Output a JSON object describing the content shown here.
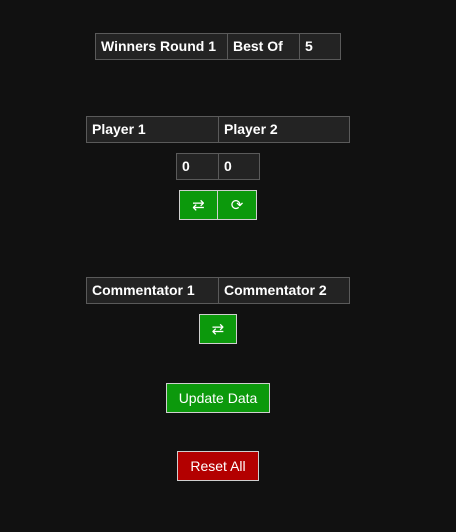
{
  "round": {
    "name": "Winners Round 1",
    "best_of_label": "Best Of",
    "best_of_value": "5"
  },
  "players": {
    "player1": "Player 1",
    "player2": "Player 2",
    "score1": "0",
    "score2": "0",
    "swap_icon": "⇄",
    "reset_icon": "⟳"
  },
  "commentators": {
    "commentator1": "Commentator 1",
    "commentator2": "Commentator 2",
    "swap_icon": "⇄"
  },
  "actions": {
    "update_label": "Update Data",
    "reset_label": "Reset All"
  },
  "colors": {
    "background": "#111111",
    "field_bg": "#232323",
    "field_border": "#5a5a5a",
    "green": "#0c990c",
    "red": "#b30000"
  },
  "icons": {
    "swap": "swap-icon",
    "reset": "reset-icon"
  }
}
